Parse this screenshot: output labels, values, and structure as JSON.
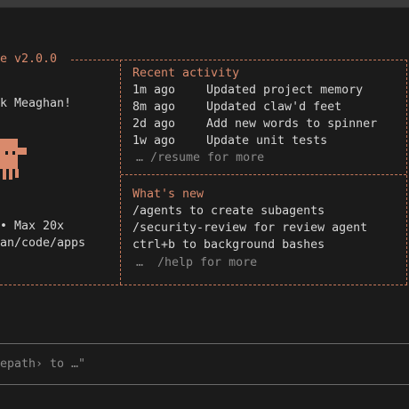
{
  "window": {
    "title_fragment": "e v2.0.0"
  },
  "welcome": {
    "greeting_fragment": "k Meaghan!",
    "plan_fragment": "• Max 20x",
    "path_fragment": "an/code/apps"
  },
  "recent_activity": {
    "heading": "Recent activity",
    "items": [
      {
        "time": "1m ago",
        "text": "Updated project memory"
      },
      {
        "time": "8m ago",
        "text": "Updated claw'd feet"
      },
      {
        "time": "2d ago",
        "text": "Add new words to spinner"
      },
      {
        "time": "1w ago",
        "text": "Update unit tests"
      }
    ],
    "more": "… /resume for more"
  },
  "whats_new": {
    "heading": "What's new",
    "items": [
      "/agents to create subagents",
      "/security-review for review agent",
      "ctrl+b to background bashes"
    ],
    "more": "…  /help for more"
  },
  "prompt": {
    "hint_fragment": "epath› to …\""
  },
  "colors": {
    "background": "#1b1b1b",
    "accent": "#d98a6c",
    "border": "#c7785a",
    "text": "#d6d6d6",
    "dim": "#8a8a8a"
  },
  "icons": [
    "mascot-icon"
  ]
}
